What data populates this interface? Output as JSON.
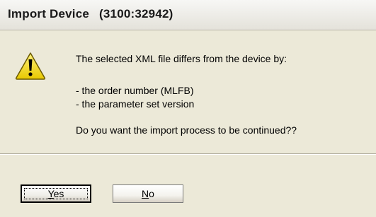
{
  "window": {
    "title": "Import Device",
    "title_id": "(3100:32942)"
  },
  "icon": "warning-icon",
  "message": {
    "line1": "The selected XML file differs from the device by:",
    "line2": "- the order number (MLFB)",
    "line3": "- the parameter set version",
    "line4": "Do you want the import process to be continued??"
  },
  "buttons": {
    "yes": {
      "mnemonic": "Y",
      "rest": "es"
    },
    "no": {
      "mnemonic": "N",
      "rest": "o"
    }
  },
  "colors": {
    "background": "#ece9d8",
    "warning_yellow": "#f5e000",
    "focus_border": "#000000"
  }
}
